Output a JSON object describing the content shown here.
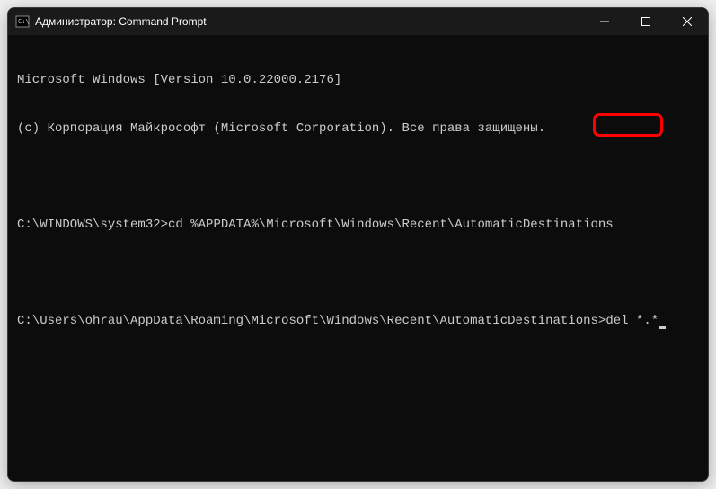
{
  "titlebar": {
    "title": "Администратор: Command Prompt"
  },
  "terminal": {
    "line1": "Microsoft Windows [Version 10.0.22000.2176]",
    "line2": "(c) Корпорация Майкрософт (Microsoft Corporation). Все права защищены.",
    "prompt1_path": "C:\\WINDOWS\\system32>",
    "prompt1_cmd": "cd %APPDATA%\\Microsoft\\Windows\\Recent\\AutomaticDestinations",
    "prompt2_path": "C:\\Users\\ohrau\\AppData\\Roaming\\Microsoft\\Windows\\Recent\\AutomaticDestinations>",
    "prompt2_cmd": "del *.*"
  }
}
